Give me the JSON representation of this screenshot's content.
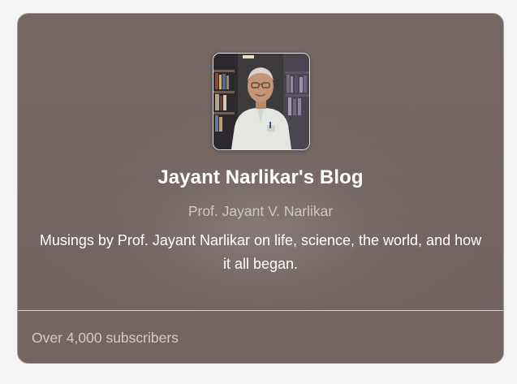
{
  "card": {
    "avatar_alt": "Jayant Narlikar",
    "title": "Jayant Narlikar's Blog",
    "author": "Prof. Jayant V. Narlikar",
    "description": "Musings by Prof. Jayant Narlikar on life, science, the world, and how it all began.",
    "subscribers": "Over 4,000 subscribers"
  },
  "colors": {
    "card_bg": "#726562",
    "title": "#ffffff",
    "muted_text": "#cfc7c4",
    "divider": "#d6cfcd"
  },
  "icons": {
    "avatar": "portrait-photo"
  }
}
